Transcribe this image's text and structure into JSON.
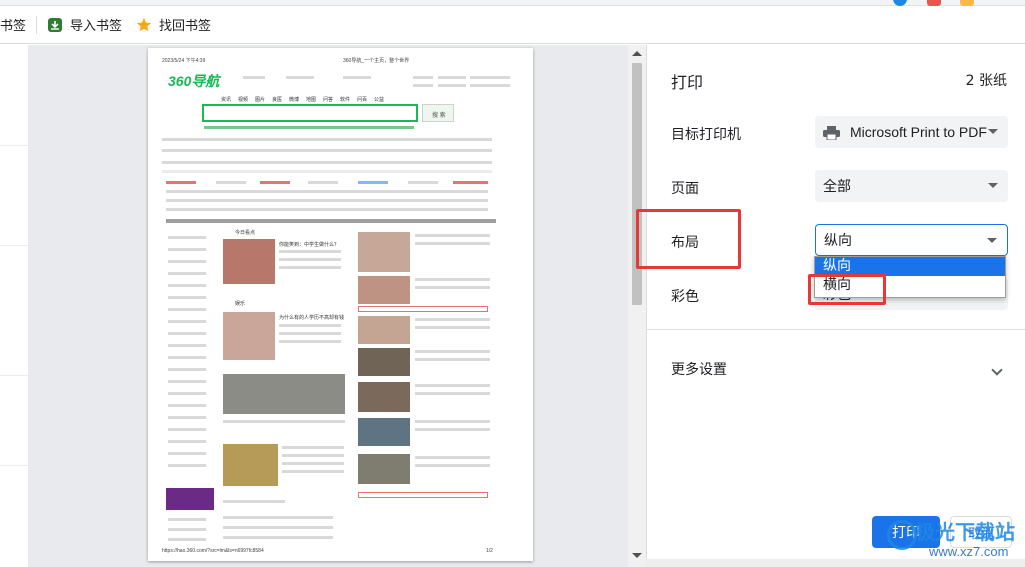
{
  "bookmarks": {
    "partial_label": "书签",
    "import_label": "导入书签",
    "retrieve_label": "找回书签"
  },
  "preview": {
    "date_header": "2023/5/24 下午4:39",
    "page_header_title": "360导航_一个主页，整个世界",
    "logo_text": "360导航",
    "search_button": "搜 索",
    "footer_url": "https://hao.360.com/?src=lm&ls=n6997fc8584",
    "footer_page": "1/2",
    "nav_tabs": [
      "资讯",
      "视频",
      "图片",
      "良医",
      "微博",
      "地图",
      "问答",
      "软件",
      "问百",
      "公益"
    ],
    "section_label_1": "今日看点",
    "section_label_2": "娱乐",
    "headline_1": "你能笑到：中学生做什么？",
    "headline_2": "为什么有的人学历不高却有钱"
  },
  "panel": {
    "title": "打印",
    "page_count": "2 张纸",
    "destination_label": "目标打印机",
    "destination_value": "Microsoft Print to PDF",
    "pages_label": "页面",
    "pages_value": "全部",
    "layout_label": "布局",
    "layout_value": "纵向",
    "color_label": "彩色",
    "color_value": "彩色",
    "more_settings_label": "更多设置",
    "layout_options": [
      "纵向",
      "横向"
    ],
    "print_button": "打印",
    "cancel_button": "取消"
  },
  "watermark": {
    "line1": "极光下载站",
    "line2": "www.xz7.com"
  },
  "colors": {
    "accent": "#1a73e8",
    "annotation_red": "#e53935",
    "brand_green": "#19b955"
  }
}
